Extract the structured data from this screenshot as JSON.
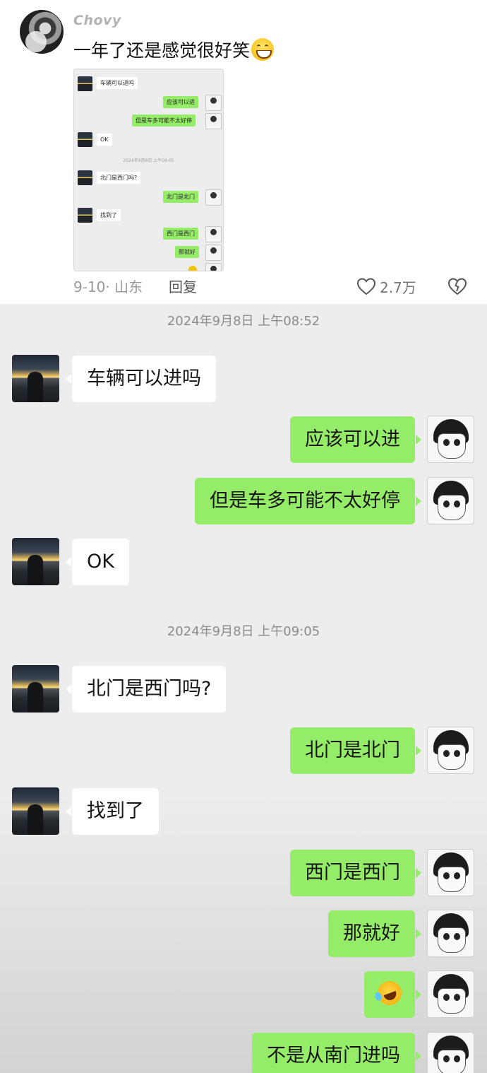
{
  "comment": {
    "username": "Chovy",
    "text": "一年了还是感觉很好笑",
    "emoji": "grinning-face-emoji",
    "date_location": "9-10· 山东",
    "reply_label": "回复",
    "like_count": "2.7万"
  },
  "thumbnail": {
    "messages": [
      {
        "side": "in",
        "text": "车辆可以进吗"
      },
      {
        "side": "out",
        "text": "应该可以进"
      },
      {
        "side": "out",
        "text": "但是车多可能不太好停"
      },
      {
        "side": "in",
        "text": "OK"
      },
      {
        "side": "out",
        "text": "北门是北门"
      },
      {
        "side": "in",
        "text": "北门是西门吗?"
      },
      {
        "side": "in",
        "text": "找到了"
      },
      {
        "side": "out",
        "text": "西门是西门"
      },
      {
        "side": "out",
        "text": "那就好"
      }
    ],
    "timestamp": "2024年9月8日 上午09:05"
  },
  "chat": {
    "timestamps": [
      "2024年9月8日 上午08:52",
      "2024年9月8日 上午09:05"
    ],
    "messages": [
      {
        "side": "in",
        "text": "车辆可以进吗"
      },
      {
        "side": "out",
        "text": "应该可以进"
      },
      {
        "side": "out",
        "text": "但是车多可能不太好停"
      },
      {
        "side": "in",
        "text": "OK"
      },
      {
        "side": "in",
        "text": "北门是西门吗?"
      },
      {
        "side": "out",
        "text": "北门是北门"
      },
      {
        "side": "in",
        "text": "找到了"
      },
      {
        "side": "out",
        "text": "西门是西门"
      },
      {
        "side": "out",
        "text": "那就好"
      },
      {
        "side": "out",
        "emoji": "rolling-on-floor-laughing-emoji"
      },
      {
        "side": "out",
        "text": "不是从南门进吗"
      }
    ]
  },
  "colors": {
    "outgoing_bubble": "#95ec69",
    "incoming_bubble": "#ffffff",
    "chat_background": "#ededed"
  }
}
